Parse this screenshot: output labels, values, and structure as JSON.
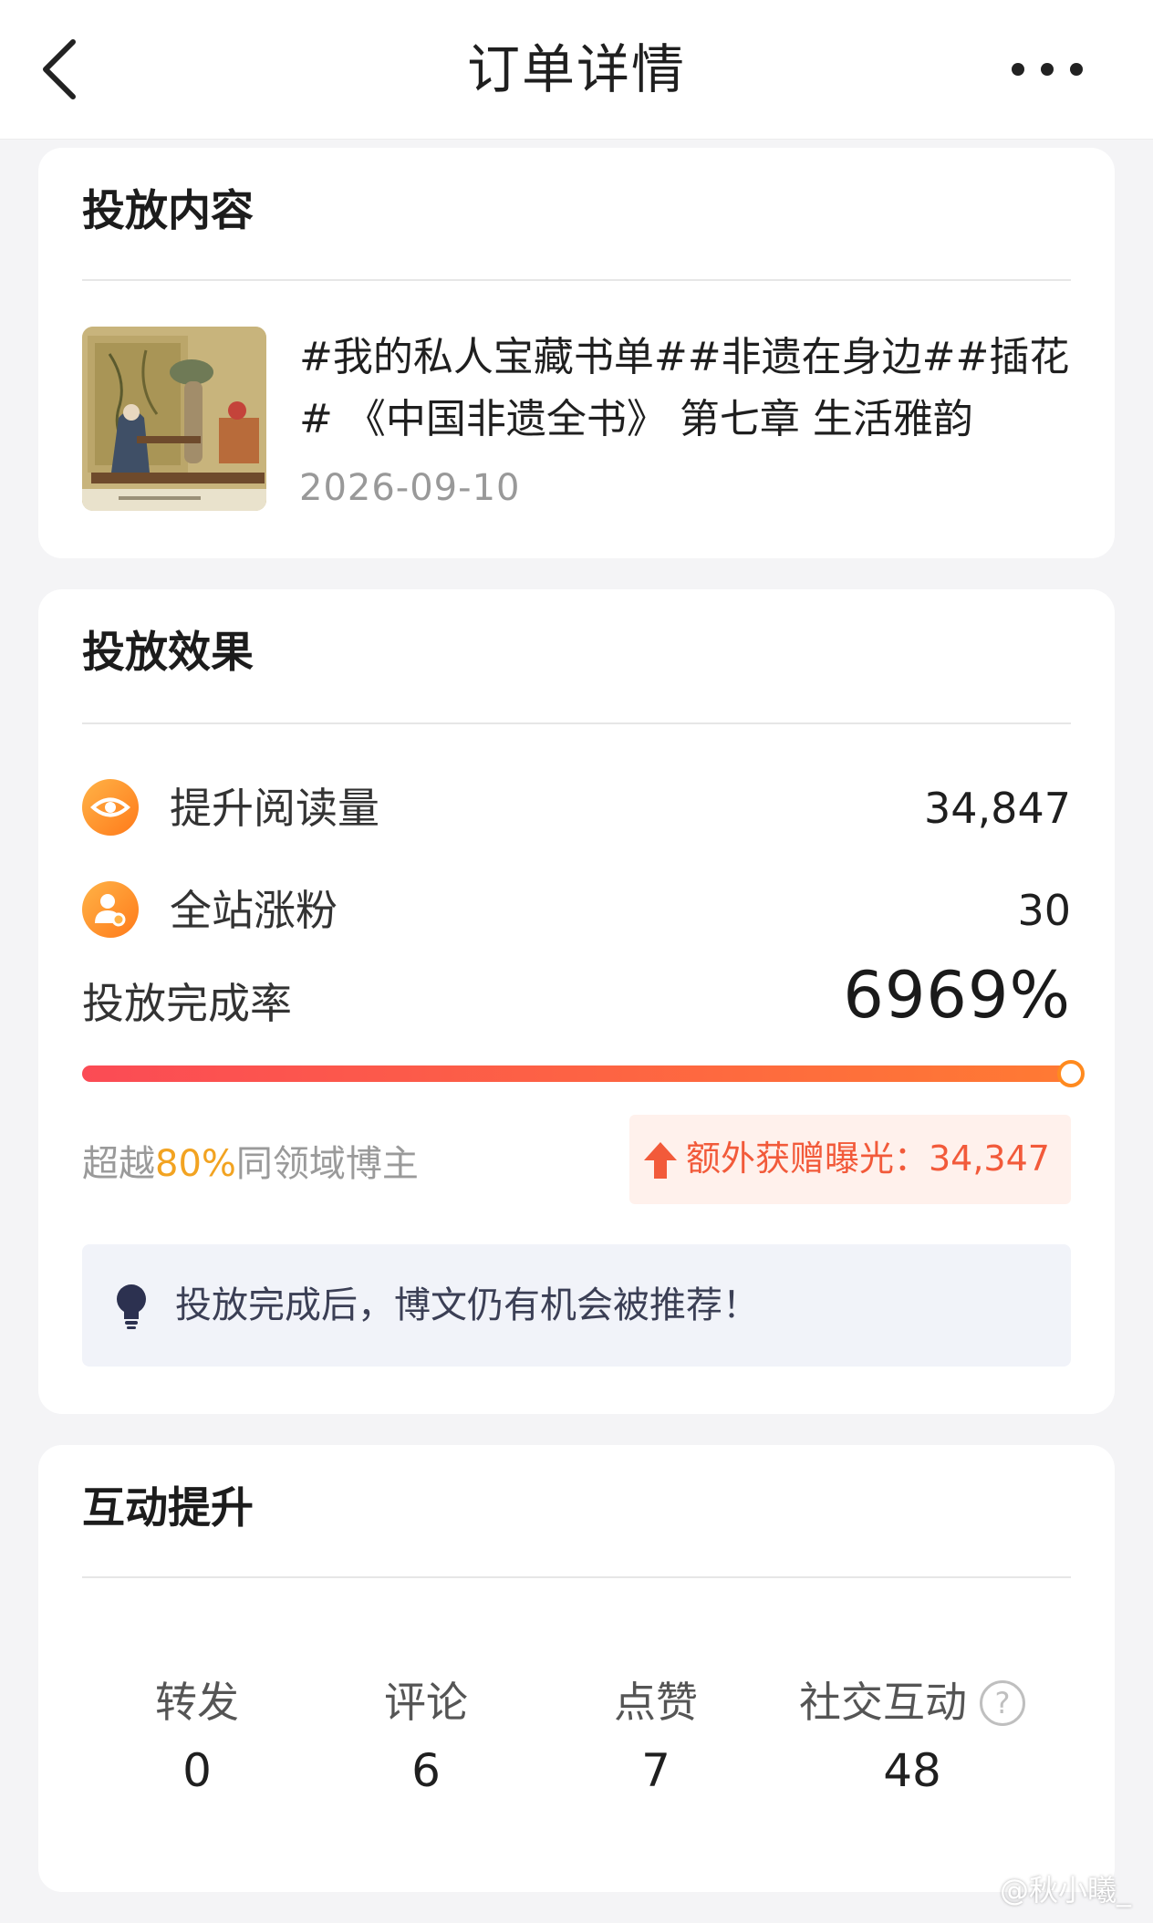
{
  "header": {
    "title": "订单详情",
    "back_icon": "chevron-left-icon",
    "more_icon": "more-dots-icon"
  },
  "content_card": {
    "title": "投放内容",
    "post_text": "#我的私人宝藏书单##非遗在身边##插花# 《中国非遗全书》 第七章 生活雅韵",
    "date": "2026-09-10"
  },
  "effect_card": {
    "title": "投放效果",
    "metrics": [
      {
        "label": "提升阅读量",
        "value": "34,847",
        "icon": "eye-icon"
      },
      {
        "label": "全站涨粉",
        "value": "30",
        "icon": "user-icon"
      }
    ],
    "completion_label": "投放完成率",
    "completion_value": "6969%",
    "progress_fraction": 1.0,
    "beyond_prefix": "超越",
    "beyond_highlight": "80%",
    "beyond_suffix": "同领域博主",
    "bonus_text": "额外获赠曝光：34,347",
    "tip_text": "投放完成后，博文仍有机会被推荐！"
  },
  "interaction_card": {
    "title": "互动提升",
    "stats": [
      {
        "label": "转发",
        "value": "0"
      },
      {
        "label": "评论",
        "value": "6"
      },
      {
        "label": "点赞",
        "value": "7"
      },
      {
        "label": "社交互动",
        "value": "48"
      }
    ],
    "help_mark": "?"
  },
  "watermark": "@秋小曦_",
  "colors": {
    "accent_orange": "#ff7a1a",
    "progress_start": "#fb4b55",
    "progress_end": "#ff7a33",
    "bonus_red": "#f25a3a",
    "highlight": "#f2a321"
  }
}
